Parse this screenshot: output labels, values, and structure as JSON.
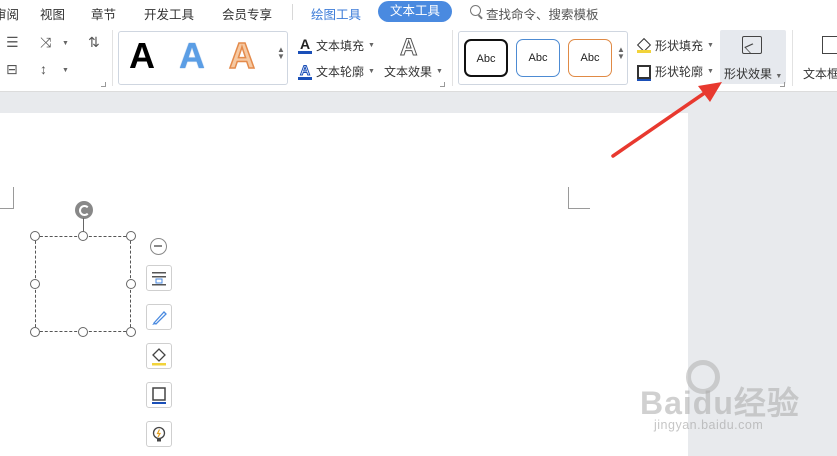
{
  "menu": {
    "items": [
      {
        "label": "审阅",
        "x_hint": "partial"
      },
      {
        "label": "视图"
      },
      {
        "label": "章节"
      },
      {
        "label": "开发工具"
      },
      {
        "label": "会员专享"
      },
      {
        "label": "绘图工具"
      },
      {
        "label": "文本工具"
      }
    ],
    "search_placeholder": "查找命令、搜索模板"
  },
  "ribbon": {
    "text_fill_label": "文本填充",
    "text_outline_label": "文本轮廓",
    "text_effect_label": "文本效果",
    "art_letter": "A",
    "shape_style_label": "Abc",
    "shape_fill_label": "形状填充",
    "shape_outline_label": "形状轮廓",
    "shape_effect_label": "形状效果",
    "textbox_label": "文本框"
  },
  "watermark": {
    "brand": "Baidu",
    "brand_cn": "经验",
    "url": "jingyan.baidu.com"
  },
  "colors": {
    "accent": "#4a8ae0",
    "arrow": "#e8392f",
    "pill_text": "#ffffff"
  },
  "icons": [
    "search-icon",
    "indent-icon",
    "text-direction-icon",
    "line-spacing-icon",
    "sort-icon",
    "paint-bucket-icon",
    "rotate-icon",
    "layout-icon",
    "pen-icon",
    "fill-icon",
    "outline-icon",
    "bulb-icon"
  ]
}
